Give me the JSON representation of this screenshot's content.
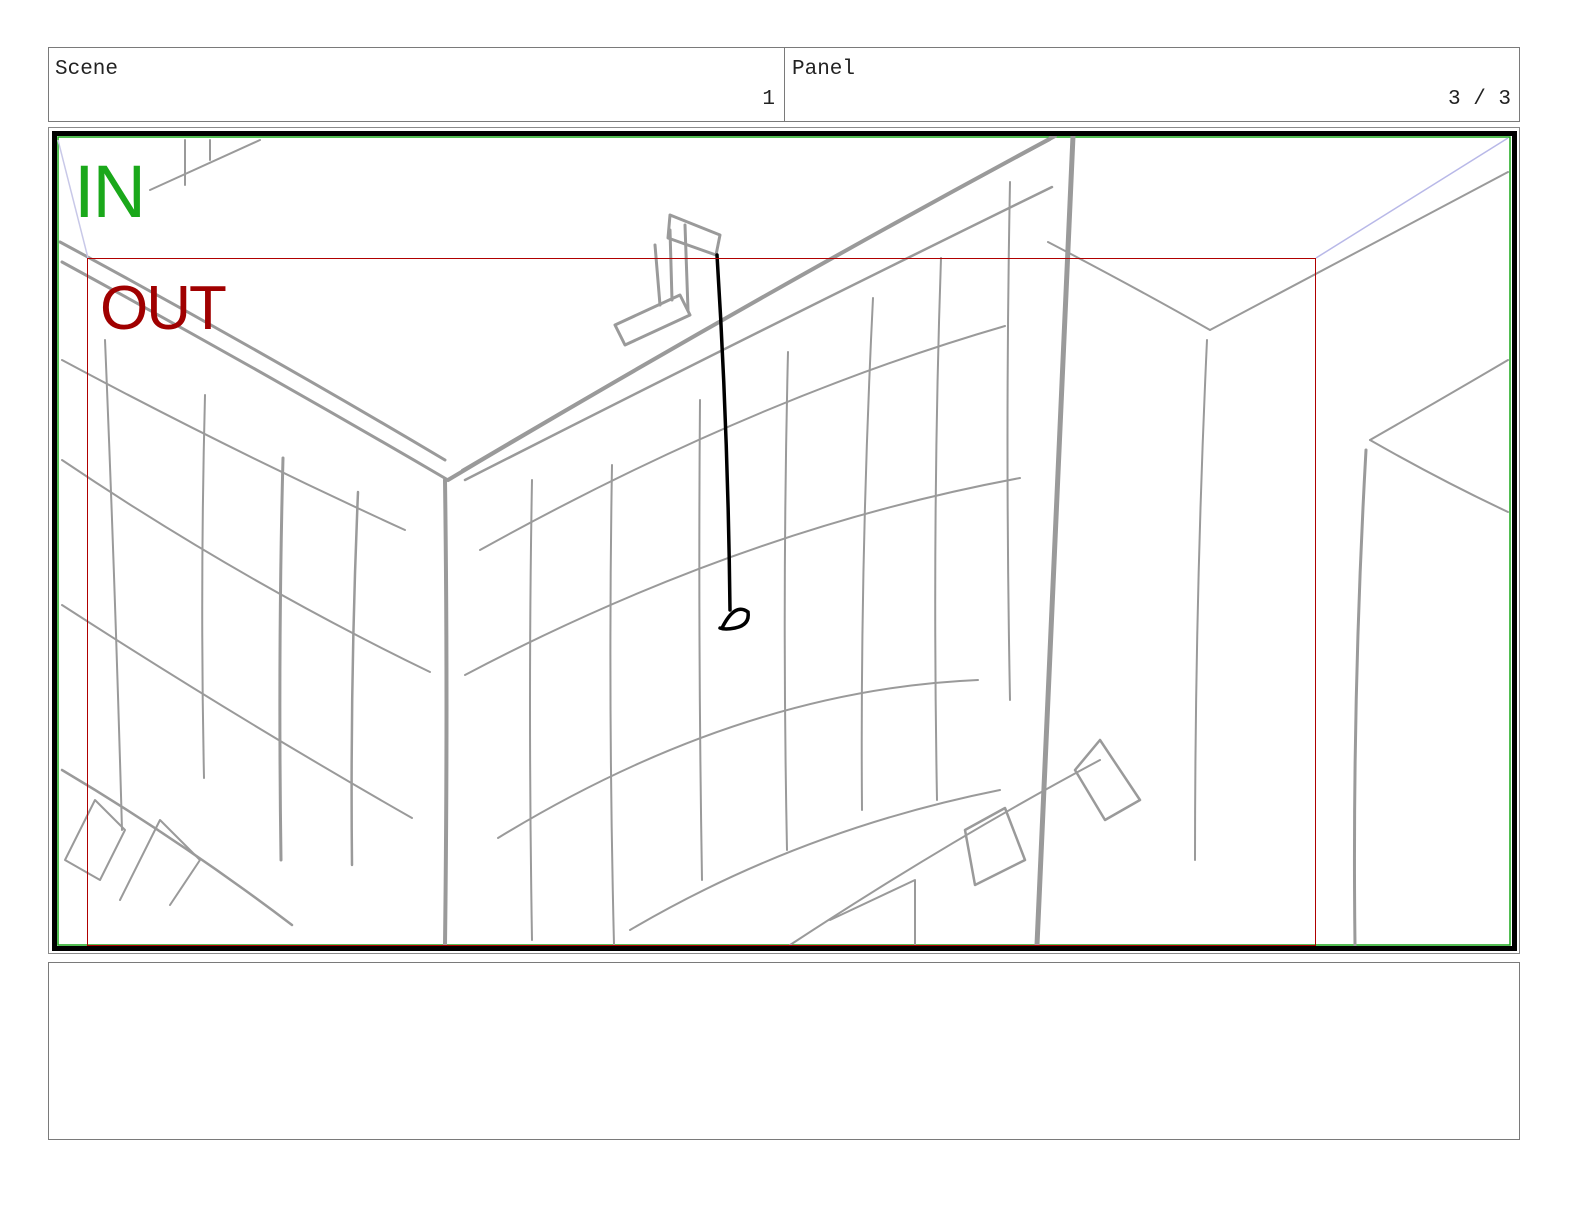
{
  "header": {
    "scene_label": "Scene",
    "scene_number": "1",
    "panel_label": "Panel",
    "panel_number": "3 / 3"
  },
  "panel": {
    "in_label": "IN",
    "out_label": "OUT",
    "colors": {
      "in_frame": "#1aa81a",
      "out_frame": "#b00000",
      "sketch": "#9a9a9a",
      "figure": "#000000"
    }
  },
  "notes": {
    "text": ""
  }
}
